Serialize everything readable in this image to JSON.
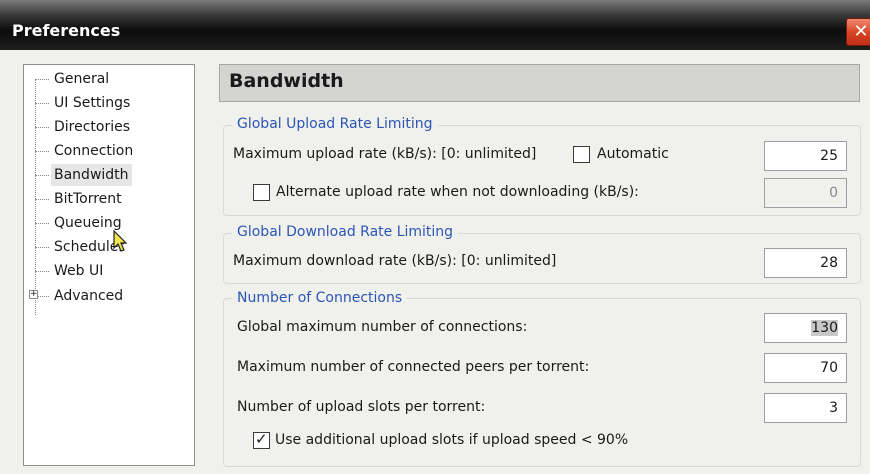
{
  "window": {
    "title": "Preferences",
    "close_glyph": "✕"
  },
  "sidebar": {
    "items": [
      {
        "label": "General"
      },
      {
        "label": "UI Settings"
      },
      {
        "label": "Directories"
      },
      {
        "label": "Connection"
      },
      {
        "label": "Bandwidth",
        "selected": true
      },
      {
        "label": "BitTorrent"
      },
      {
        "label": "Queueing"
      },
      {
        "label": "Scheduler"
      },
      {
        "label": "Web UI"
      },
      {
        "label": "Advanced",
        "expander": "+"
      }
    ]
  },
  "panel": {
    "title": "Bandwidth",
    "upload": {
      "group_title": "Global Upload Rate Limiting",
      "max_label": "Maximum upload rate (kB/s): [0: unlimited]",
      "automatic_label": "Automatic",
      "automatic_checked": false,
      "max_value": "25",
      "alt_label": "Alternate upload rate when not downloading (kB/s):",
      "alt_checked": false,
      "alt_value": "0"
    },
    "download": {
      "group_title": "Global Download Rate Limiting",
      "max_label": "Maximum download rate (kB/s): [0: unlimited]",
      "max_value": "28"
    },
    "connections": {
      "group_title": "Number of Connections",
      "global_label": "Global maximum number of connections:",
      "global_value": "130",
      "peers_label": "Maximum number of connected peers per torrent:",
      "peers_value": "70",
      "slots_label": "Number of upload slots per torrent:",
      "slots_value": "3",
      "extra_slots_label": "Use additional upload slots if upload speed < 90%",
      "extra_slots_checked": true,
      "check_glyph": "✓"
    }
  },
  "colors": {
    "group_title": "#2c56b4",
    "close_button": "#d84122"
  }
}
